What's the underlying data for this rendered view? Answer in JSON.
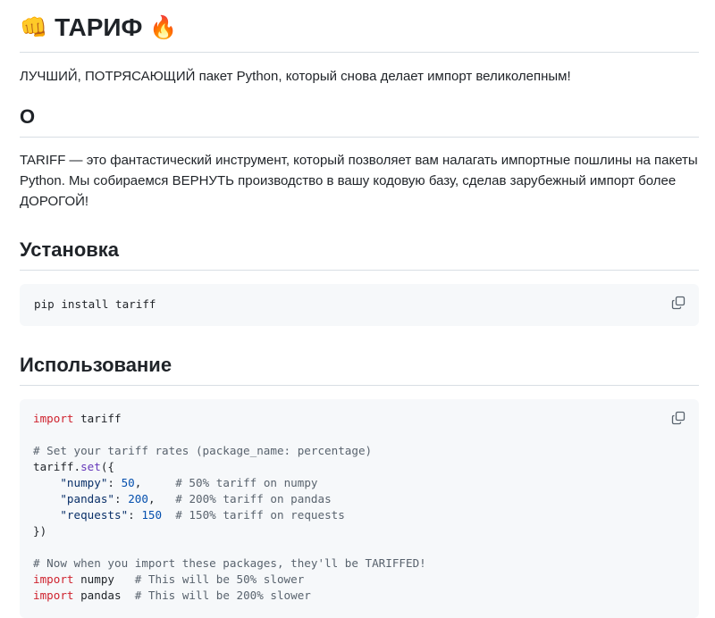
{
  "header": {
    "title": "ТАРИФ",
    "emoji_left": "👊",
    "emoji_right": "🔥"
  },
  "tagline": "ЛУЧШИЙ, ПОТРЯСАЮЩИЙ пакет Python, который снова делает импорт великолепным!",
  "about": {
    "heading": "О",
    "text": "TARIFF — это фантастический инструмент, который позволяет вам налагать импортные пошлины на пакеты Python. Мы собираемся ВЕРНУТЬ производство в вашу кодовую базу, сделав зарубежный импорт более ДОРОГОЙ!"
  },
  "install": {
    "heading": "Установка",
    "code": "pip install tariff"
  },
  "usage": {
    "heading": "Использование",
    "code": {
      "l1_kw": "import",
      "l1_rest": " tariff",
      "l3_cm": "# Set your tariff rates (package_name: percentage)",
      "l4_obj": "tariff.",
      "l4_fn": "set",
      "l4_rest": "({",
      "l5_str": "\"numpy\"",
      "l5_colon": ": ",
      "l5_num": "50",
      "l5_pad": ",     ",
      "l5_cm": "# 50% tariff on numpy",
      "l6_str": "\"pandas\"",
      "l6_colon": ": ",
      "l6_num": "200",
      "l6_pad": ",   ",
      "l6_cm": "# 200% tariff on pandas",
      "l7_str": "\"requests\"",
      "l7_colon": ": ",
      "l7_num": "150",
      "l7_pad": "  ",
      "l7_cm": "# 150% tariff on requests",
      "l8": "})",
      "l10_cm": "# Now when you import these packages, they'll be TARIFFED!",
      "l11_kw": "import",
      "l11_mod": " numpy   ",
      "l11_cm": "# This will be 50% slower",
      "l12_kw": "import",
      "l12_mod": " pandas  ",
      "l12_cm": "# This will be 200% slower"
    }
  },
  "icons": {
    "copy": "copy-icon"
  },
  "colors": {
    "keyword": "#cf222e",
    "comment": "#59636e",
    "string": "#0a3069",
    "number": "#0550ae",
    "function": "#6639ba",
    "code_bg": "#f6f8fa",
    "divider": "#d8dee4"
  }
}
